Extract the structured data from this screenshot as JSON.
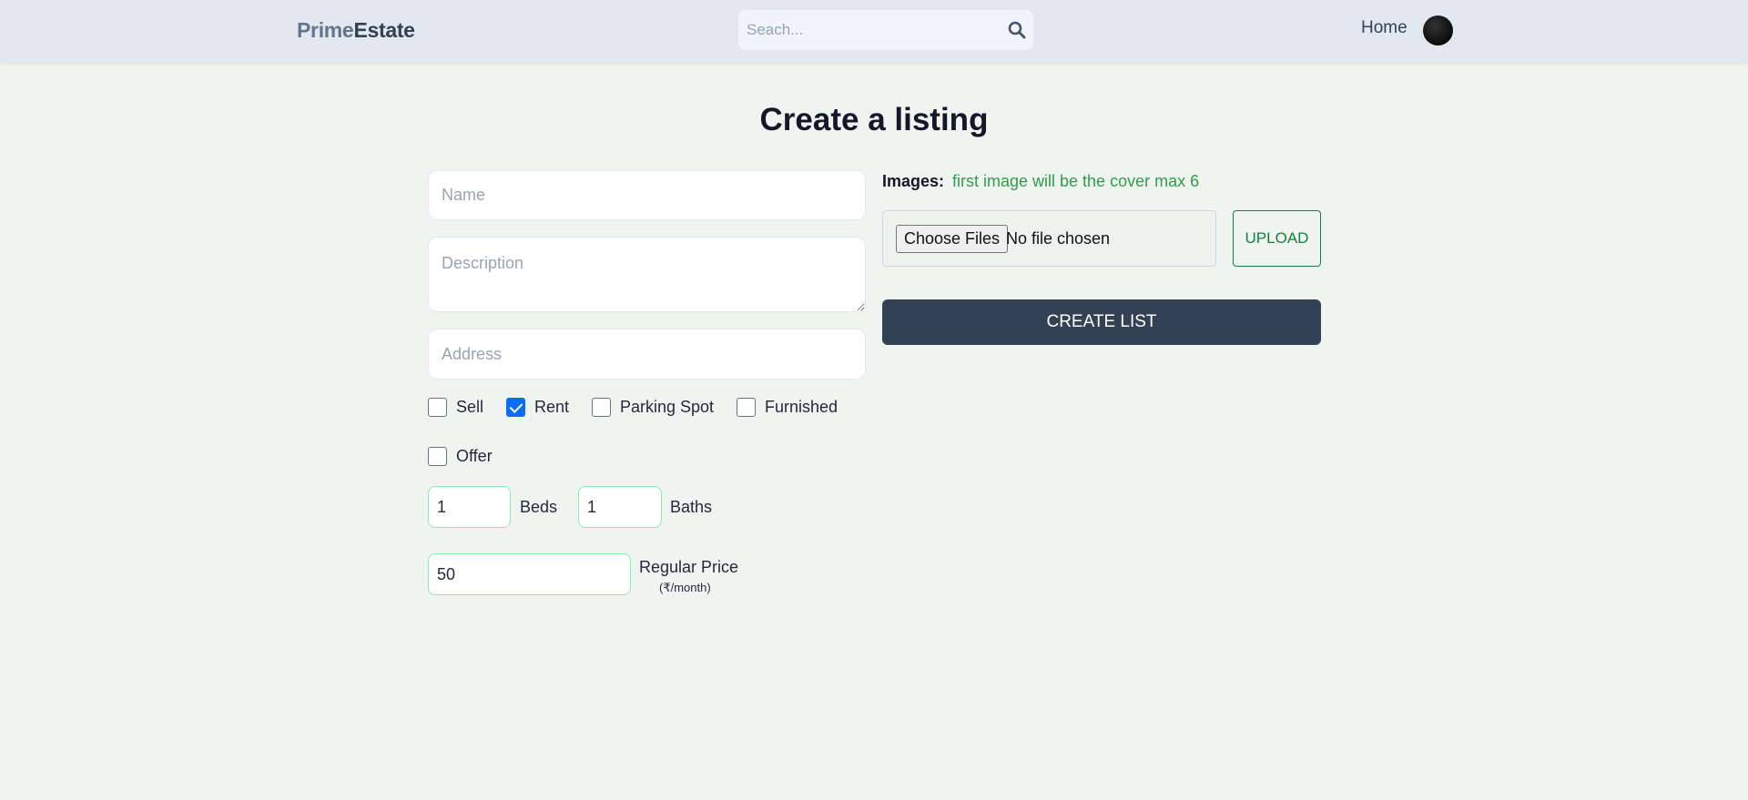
{
  "header": {
    "logo_part1": "Prime",
    "logo_part2": "Estate",
    "search_placeholder": "Seach...",
    "nav_home": "Home"
  },
  "page": {
    "title": "Create a listing"
  },
  "form": {
    "name_placeholder": "Name",
    "description_placeholder": "Description",
    "address_placeholder": "Address",
    "checkboxes": [
      {
        "label": "Sell",
        "checked": false
      },
      {
        "label": "Rent",
        "checked": true
      },
      {
        "label": "Parking Spot",
        "checked": false
      },
      {
        "label": "Furnished",
        "checked": false
      },
      {
        "label": "Offer",
        "checked": false
      }
    ],
    "beds_value": "1",
    "beds_label": "Beds",
    "baths_value": "1",
    "baths_label": "Baths",
    "price_value": "50",
    "price_label": "Regular Price",
    "price_unit": "(₹/month)"
  },
  "images": {
    "label": "Images:",
    "hint": "first image will be the cover max 6",
    "choose_files": "Choose Files",
    "file_status": "No file chosen",
    "upload_label": "UPLOAD"
  },
  "actions": {
    "create_label": "CREATE LIST"
  },
  "colors": {
    "header_bg": "#e2e8f0",
    "page_bg": "#f0f4f1",
    "primary_button": "#334155",
    "accent_green": "#15803d",
    "checkbox_blue": "#0b6cf6"
  }
}
